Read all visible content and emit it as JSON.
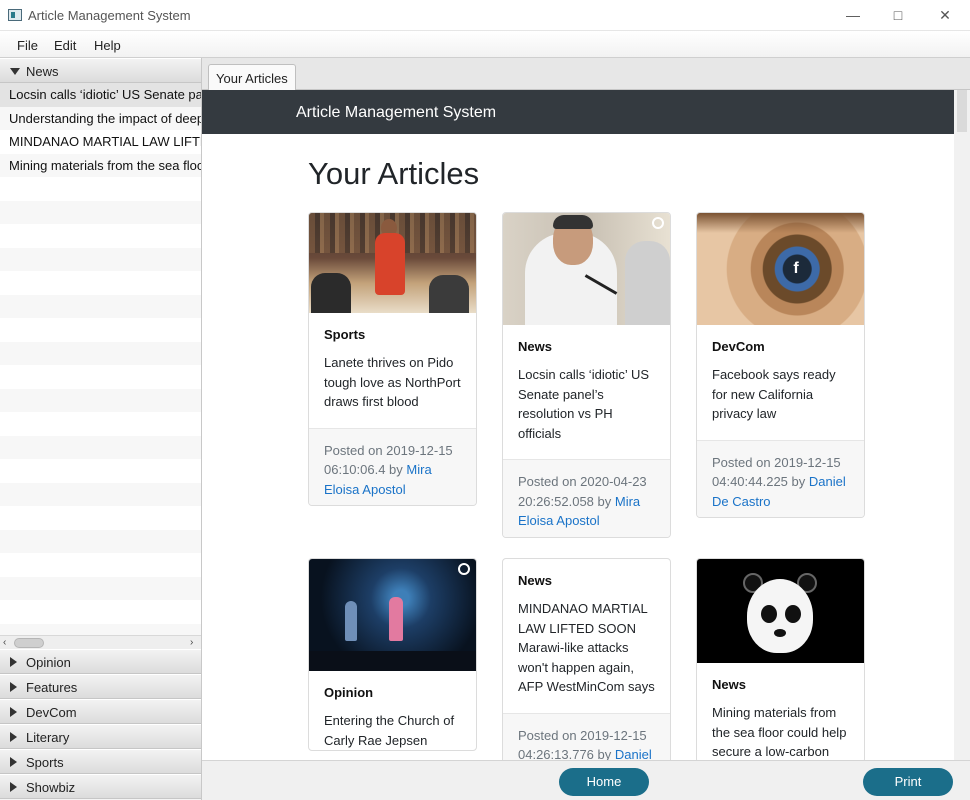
{
  "window": {
    "title": "Article Management System"
  },
  "menu": [
    "File",
    "Edit",
    "Help"
  ],
  "sidebar": {
    "expanded": {
      "label": "News",
      "items": [
        "Locsin calls ‘idiotic’ US Senate panel’s",
        "Understanding the impact of deep-sea",
        "MINDANAO MARTIAL LAW LIFTED SOON",
        "Mining materials from the sea floor could"
      ]
    },
    "collapsed": [
      "Opinion",
      "Features",
      "DevCom",
      "Literary",
      "Sports",
      "Showbiz"
    ]
  },
  "tab": {
    "label": "Your Articles"
  },
  "page": {
    "brand": "Article Management System",
    "heading": "Your Articles",
    "cards": [
      {
        "category": "Sports",
        "title": "Lanete thrives on Pido tough love as NorthPort draws first blood",
        "posted": "Posted on 2019-12-15 06:10:06.4 by ",
        "author": "Mira Eloisa Apostol",
        "image": "basketball-photo"
      },
      {
        "category": "News",
        "title": "Locsin calls ‘idiotic’ US Senate panel’s resolution vs PH officials",
        "posted": "Posted on 2020-04-23 20:26:52.058 by ",
        "author": "Mira Eloisa Apostol",
        "image": "press-conference-photo"
      },
      {
        "category": "DevCom",
        "title": "Facebook says ready for new California privacy law",
        "posted": "Posted on 2019-12-15 04:40:44.225 by ",
        "author": "Daniel De Castro",
        "image": "eye-facebook-photo"
      },
      {
        "category": "Opinion",
        "title": "Entering the Church of Carly Rae Jepsen",
        "image": "concert-photo"
      },
      {
        "category": "News",
        "title": "MINDANAO MARTIAL LAW LIFTED SOON Marawi-like attacks won't happen again, AFP WestMinCom says",
        "posted": "Posted on 2019-12-15 04:26:13.776 by ",
        "author": "Daniel",
        "image": ""
      },
      {
        "category": "News",
        "title": "Mining materials from the sea floor could help secure a low-carbon",
        "image": "panda-photo"
      }
    ]
  },
  "buttons": {
    "home": "Home",
    "print": "Print"
  },
  "colors": {
    "navbar": "#343a40",
    "button": "#1b6e8a",
    "link": "#1a73c8"
  }
}
